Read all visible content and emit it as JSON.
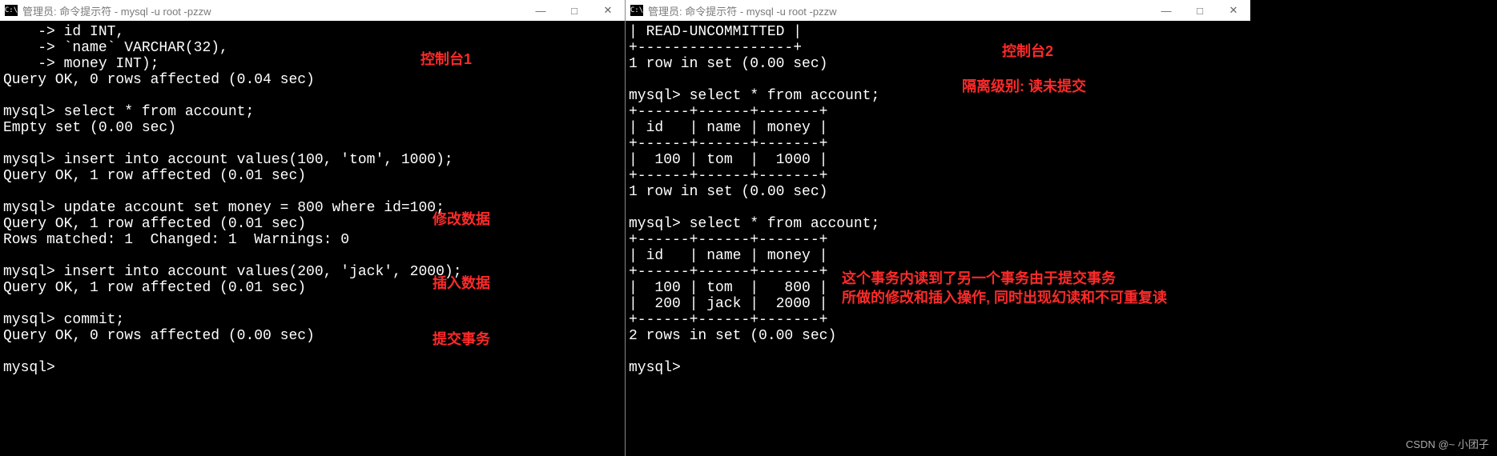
{
  "left": {
    "title": "管理员: 命令提示符 - mysql  -u root -pzzw",
    "lines": [
      "    -> id INT,",
      "    -> `name` VARCHAR(32),",
      "    -> money INT);",
      "Query OK, 0 rows affected (0.04 sec)",
      "",
      "mysql> select * from account;",
      "Empty set (0.00 sec)",
      "",
      "mysql> insert into account values(100, 'tom', 1000);",
      "Query OK, 1 row affected (0.01 sec)",
      "",
      "mysql> update account set money = 800 where id=100;",
      "Query OK, 1 row affected (0.01 sec)",
      "Rows matched: 1  Changed: 1  Warnings: 0",
      "",
      "mysql> insert into account values(200, 'jack', 2000);",
      "Query OK, 1 row affected (0.01 sec)",
      "",
      "mysql> commit;",
      "Query OK, 0 rows affected (0.00 sec)",
      "",
      "mysql>"
    ],
    "annotations": {
      "console": "控制台1",
      "modify": "修改数据",
      "insert": "插入数据",
      "commit": "提交事务"
    }
  },
  "right": {
    "title": "管理员: 命令提示符 - mysql  -u root -pzzw",
    "lines": [
      "| READ-UNCOMMITTED |",
      "+------------------+",
      "1 row in set (0.00 sec)",
      "",
      "mysql> select * from account;",
      "+------+------+-------+",
      "| id   | name | money |",
      "+------+------+-------+",
      "|  100 | tom  |  1000 |",
      "+------+------+-------+",
      "1 row in set (0.00 sec)",
      "",
      "mysql> select * from account;",
      "+------+------+-------+",
      "| id   | name | money |",
      "+------+------+-------+",
      "|  100 | tom  |   800 |",
      "|  200 | jack |  2000 |",
      "+------+------+-------+",
      "2 rows in set (0.00 sec)",
      "",
      "mysql>"
    ],
    "annotations": {
      "console": "控制台2",
      "isolation": "隔离级别: 读未提交",
      "note1": "这个事务内读到了另一个事务由于提交事务",
      "note2": "所做的修改和插入操作, 同时出现幻读和不可重复读"
    }
  },
  "winbtns": {
    "min": "—",
    "max": "□",
    "close": "✕"
  },
  "iconText": "C:\\",
  "watermark": "CSDN @~ 小团子"
}
